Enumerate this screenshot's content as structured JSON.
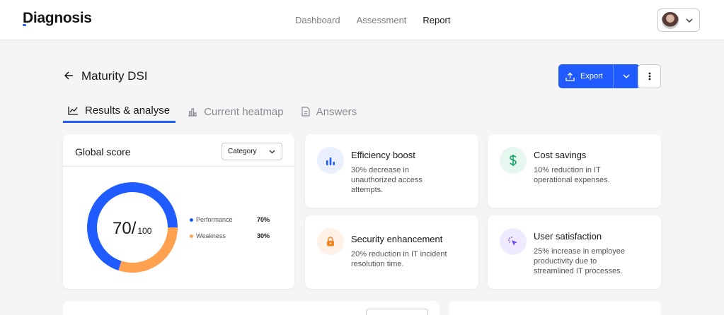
{
  "app": {
    "logo": "Diagnosis"
  },
  "nav": {
    "items": [
      "Dashboard",
      "Assessment",
      "Report"
    ],
    "active": "Report"
  },
  "page": {
    "title": "Maturity DSI"
  },
  "actions": {
    "export_label": "Export"
  },
  "tabs": [
    {
      "label": "Results & analyse",
      "icon": "line-chart-icon",
      "active": true
    },
    {
      "label": "Current heatmap",
      "icon": "bar-chart-icon",
      "active": false
    },
    {
      "label": "Answers",
      "icon": "document-icon",
      "active": false
    }
  ],
  "global_score": {
    "title": "Global score",
    "filter": "Category",
    "score": "70/",
    "max": "100",
    "legend": [
      {
        "label": "Performance",
        "value": "70%",
        "color": "#1f5bff"
      },
      {
        "label": "Weakness",
        "value": "30%",
        "color": "#ffa14f"
      }
    ],
    "chart_data": {
      "type": "pie",
      "categories": [
        "Performance",
        "Weakness"
      ],
      "values": [
        70,
        30
      ]
    }
  },
  "kpis": [
    {
      "title": "Efficiency boost",
      "desc": [
        "30% decrease in",
        "unauthorized access",
        "attempts."
      ],
      "icon": "bar-chart-icon",
      "icon_bg": "#e9efff",
      "icon_color": "#1f5bff"
    },
    {
      "title": "Cost savings",
      "desc": [
        "10% reduction in IT",
        "operational expenses."
      ],
      "icon": "dollar-icon",
      "icon_bg": "#e6f7ef",
      "icon_color": "#1aa267"
    },
    {
      "title": "Security enhancement",
      "desc": [
        "20% reduction in IT incident",
        "resolution time."
      ],
      "icon": "lock-icon",
      "icon_bg": "#fff1e6",
      "icon_color": "#f28322"
    },
    {
      "title": "User satisfaction",
      "desc": [
        "25% increase in employee",
        "productivity due to",
        "streamlined IT processes."
      ],
      "icon": "cursor-click-icon",
      "icon_bg": "#efeaff",
      "icon_color": "#7a4ff0"
    }
  ]
}
